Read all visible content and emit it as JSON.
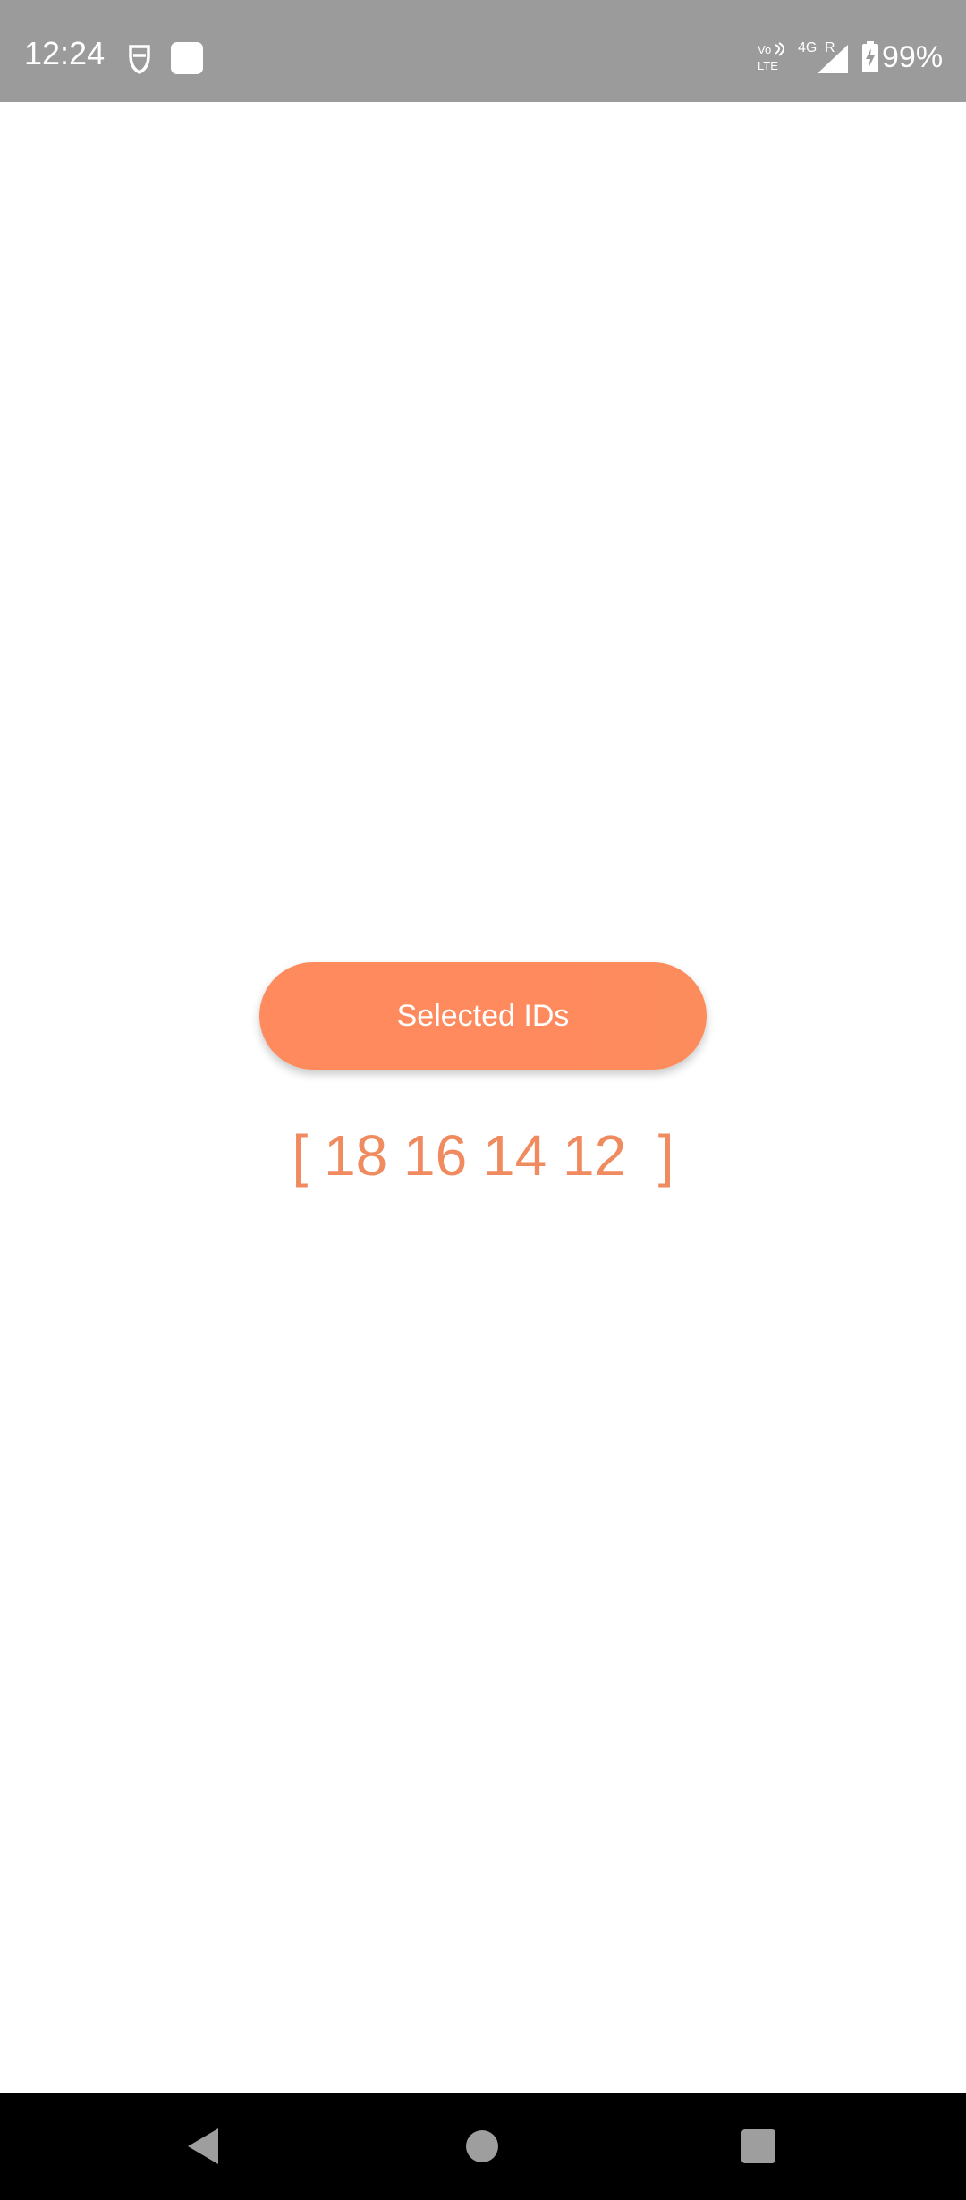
{
  "status_bar": {
    "time": "12:24",
    "battery": "99%",
    "network": "4G",
    "icons": {
      "secure": "secure-vpn-icon",
      "app": "app-notification-icon",
      "volte": "volte-icon",
      "signal": "signal-4g-icon",
      "battery": "battery-charging-icon"
    }
  },
  "main": {
    "button_label": "Selected IDs",
    "ids_display": "[ 18 16 14 12  ]",
    "accent_color": "#fe8a5e"
  },
  "nav_bar": {
    "back": "back-icon",
    "home": "home-icon",
    "recents": "recents-icon"
  }
}
